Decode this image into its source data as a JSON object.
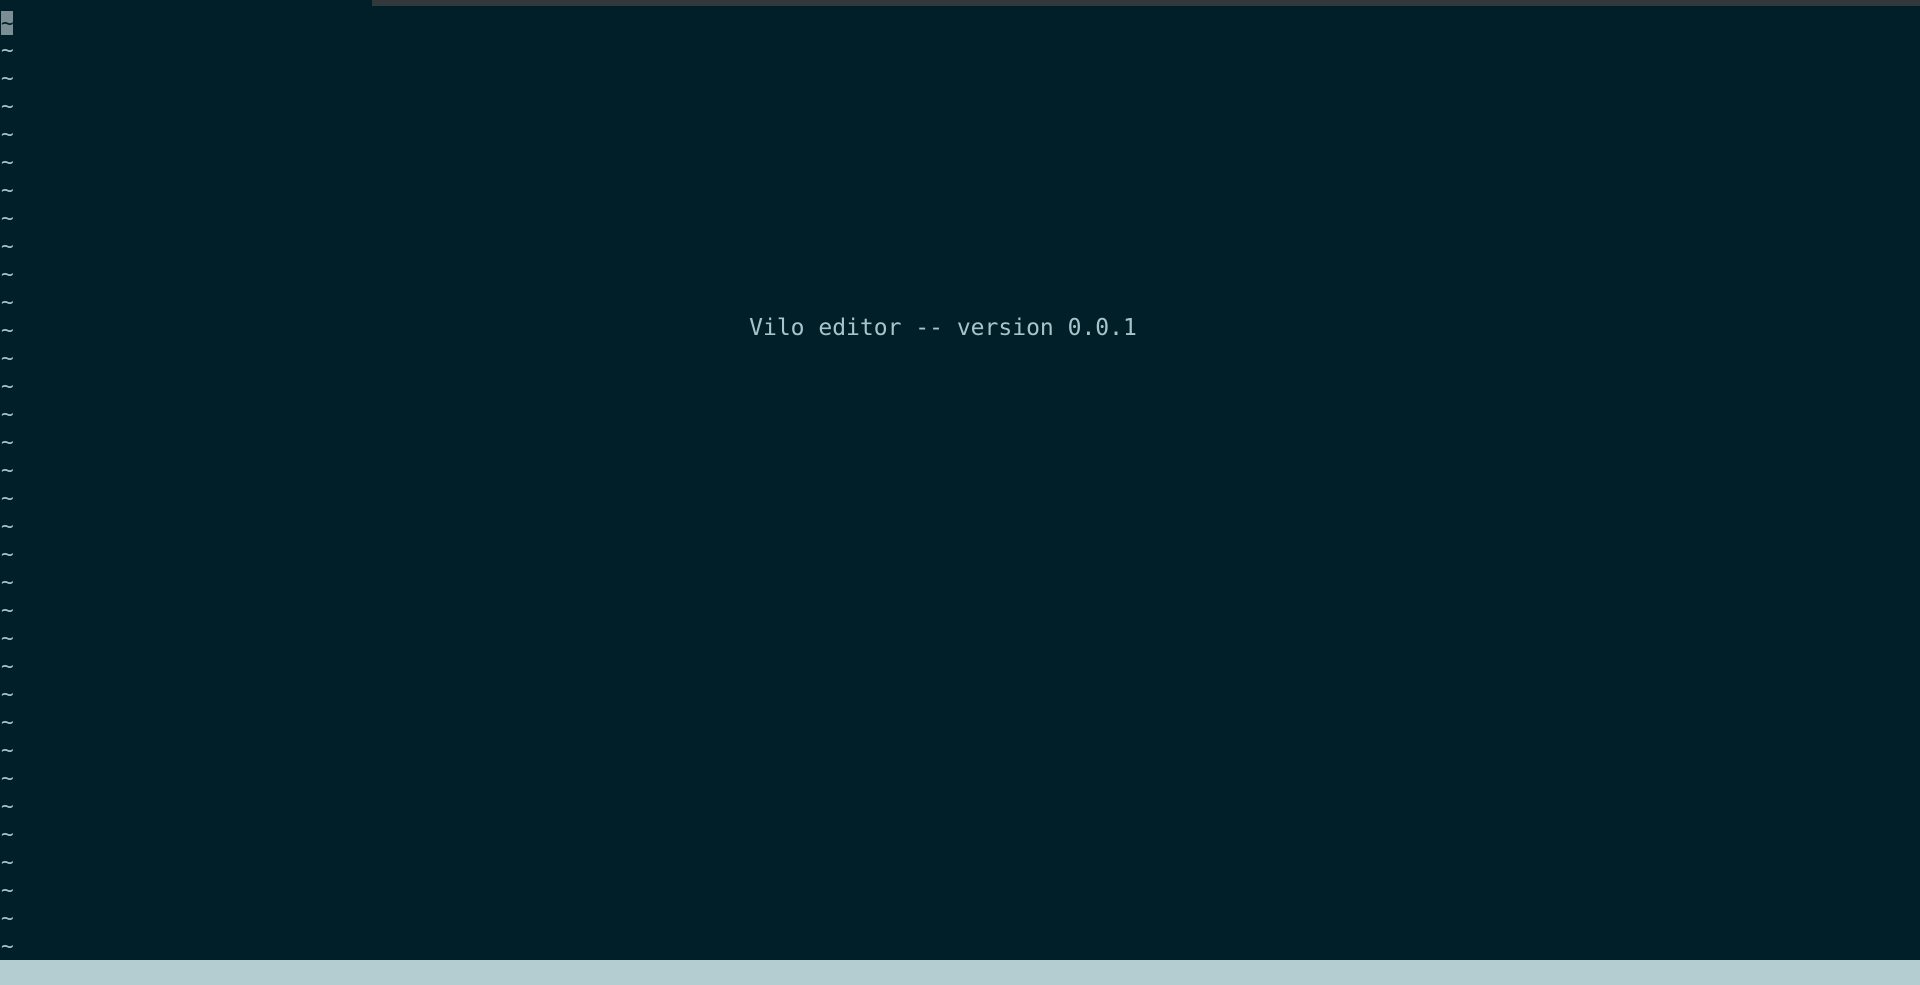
{
  "editor": {
    "name": "Vilo",
    "welcome_message": "Vilo editor -- version 0.0.1",
    "empty_line_marker": "~",
    "empty_line_count": 34,
    "status_text": ""
  },
  "colors": {
    "background": "#001f28",
    "foreground": "#a8c4ca",
    "cursor": "#7a8e93",
    "status_bar": "#b3cdd1"
  }
}
